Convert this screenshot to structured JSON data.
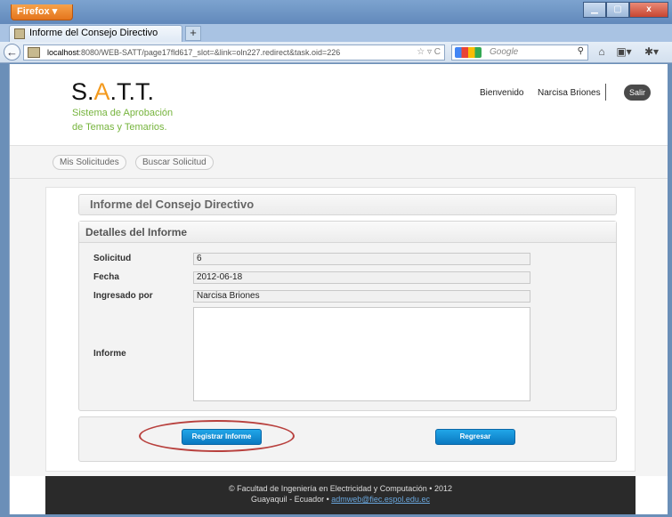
{
  "browser": {
    "app_button": "Firefox",
    "tab_title": "Informe del Consejo Directivo",
    "new_tab_label": "+",
    "url_host": "localhost",
    "url_rest": ":8080/WEB-SATT/page17fld617_slot=&link=oln227.redirect&task.oid=226",
    "search_placeholder": "Google",
    "window_controls": [
      "minimize",
      "maximize",
      "close"
    ]
  },
  "header": {
    "logo_prefix": "S.",
    "logo_orange": "A",
    "logo_suffix": ".T.T.",
    "logo_subtitle_line1": "Sistema de Aprobación",
    "logo_subtitle_line2": "de Temas y Temarios.",
    "welcome_text": "Bienvenido",
    "user_name": "Narcisa Briones",
    "logout_label": "Salir"
  },
  "subnav": {
    "items": [
      {
        "label": "Mis Solicitudes"
      },
      {
        "label": "Buscar Solicitud"
      }
    ]
  },
  "main": {
    "panel_title": "Informe del Consejo Directivo",
    "details_title": "Detalles del Informe",
    "fields": [
      {
        "label": "Solicitud",
        "value": "6"
      },
      {
        "label": "Fecha",
        "value": "2012-06-18"
      },
      {
        "label": "Ingresado por",
        "value": "Narcisa Briones"
      },
      {
        "label": "Informe",
        "value": ""
      }
    ],
    "buttons": {
      "register": "Registrar Informe",
      "back": "Regresar"
    }
  },
  "footer": {
    "line1": "© Facultad de Ingeniería en Electricidad y Computación • 2012",
    "line2_prefix": "Guayaquil - Ecuador • ",
    "email": "admweb@fiec.espol.edu.ec"
  },
  "colors": {
    "accent_orange": "#f39a1e",
    "subtitle_green": "#76b43d",
    "button_blue": "#1290d6",
    "annotation_red": "#b8403d"
  }
}
